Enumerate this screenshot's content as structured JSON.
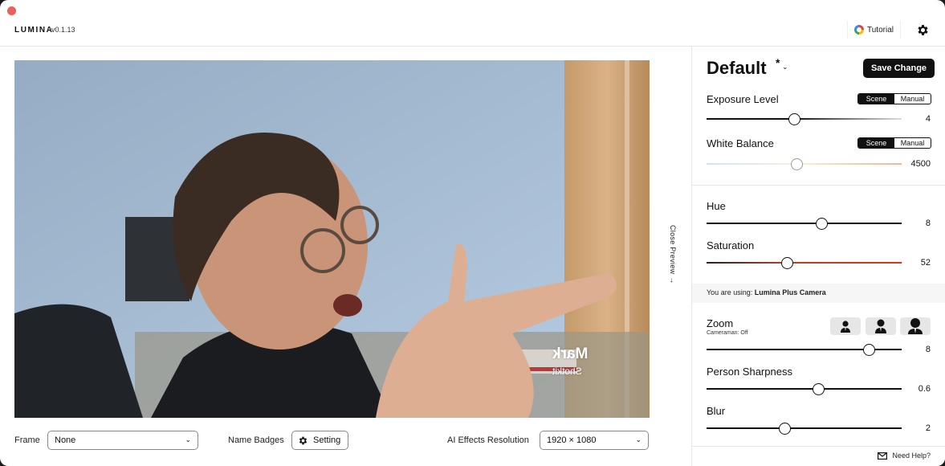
{
  "app": {
    "name": "LUMINA",
    "version": "v0.1.13",
    "tutorial_label": "Tutorial"
  },
  "preview": {
    "close_label": "Close Preview →",
    "name_badge": {
      "name": "Mark",
      "company": "Shotkit"
    }
  },
  "bottom_bar": {
    "frame_label": "Frame",
    "frame_value": "None",
    "name_badges_label": "Name Badges",
    "setting_label": "Setting",
    "resolution_label": "AI Effects Resolution",
    "resolution_value": "1920 × 1080"
  },
  "panel": {
    "preset_title": "Default",
    "modified_marker": "*",
    "save_label": "Save Change",
    "mode_options": [
      "Scene",
      "Manual"
    ],
    "controls": {
      "exposure": {
        "label": "Exposure Level",
        "value": "4",
        "fraction": 0.45,
        "mode": "Scene"
      },
      "white_balance": {
        "label": "White Balance",
        "value": "4500",
        "fraction": 0.46,
        "mode": "Scene"
      },
      "hue": {
        "label": "Hue",
        "value": "8",
        "fraction": 0.59
      },
      "saturation": {
        "label": "Saturation",
        "value": "52",
        "fraction": 0.41
      },
      "zoom": {
        "label": "Zoom",
        "value": "8",
        "fraction": 0.83,
        "sublabel": "Cameraman: Off"
      },
      "sharpness": {
        "label": "Person Sharpness",
        "value": "0.6",
        "fraction": 0.57
      },
      "blur": {
        "label": "Blur",
        "value": "2",
        "fraction": 0.4
      }
    },
    "using_prefix": "You are using:",
    "camera_name": "Lumina Plus Camera",
    "help_label": "Need Help?"
  },
  "colors": {
    "accent": "#111111",
    "saturation_track": "#e2331b",
    "close_dot": "#ec5f5a"
  }
}
